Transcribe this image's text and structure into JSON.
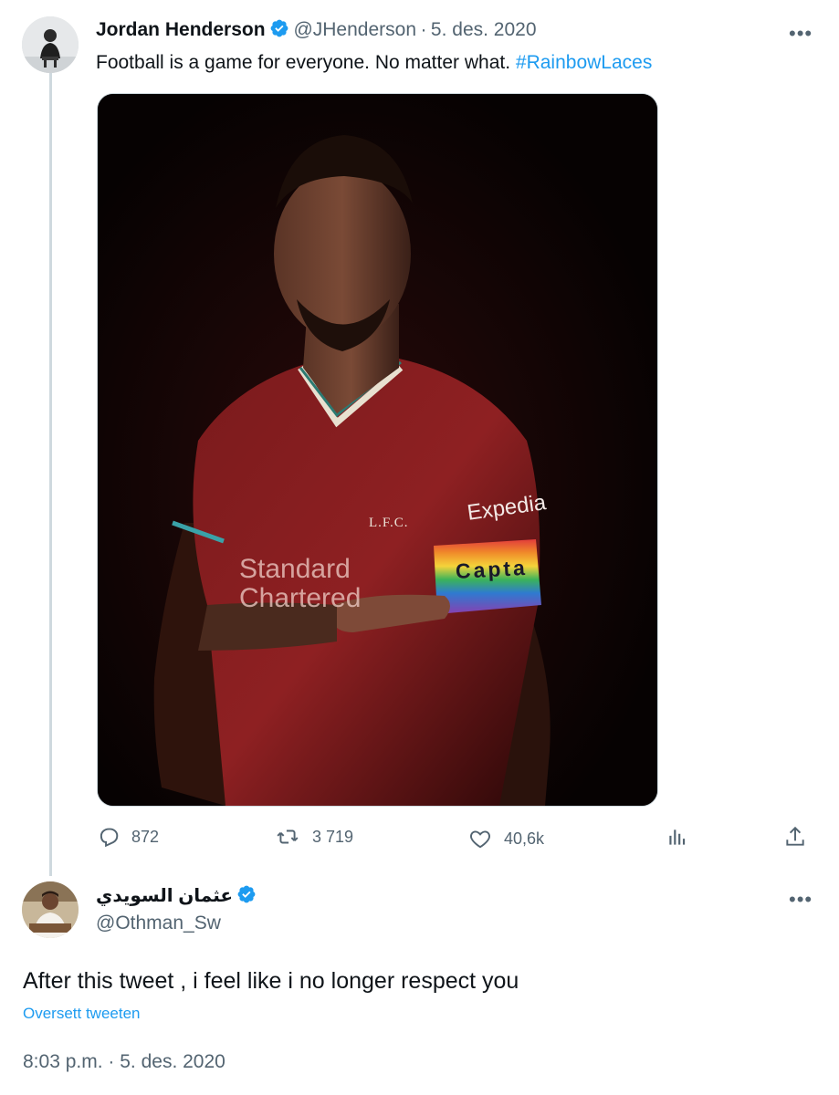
{
  "tweet": {
    "author_name": "Jordan Henderson",
    "handle": "@JHenderson",
    "separator": "·",
    "date": "5. des. 2020",
    "text": "Football is a game for everyone. No matter what.",
    "hashtag": "#RainbowLaces",
    "media": {
      "jersey_sponsor": "Standard\nChartered",
      "jersey_crest": "L.F.C.",
      "sleeve_sponsor": "Expedia",
      "armband_text": "Capta"
    },
    "actions": {
      "replies": "872",
      "retweets": "3 719",
      "likes": "40,6k"
    }
  },
  "reply": {
    "author_name": "عثمان السويدي",
    "handle": "@Othman_Sw",
    "text": "After this tweet , i feel like i no longer respect you",
    "translate_label": "Oversett tweeten",
    "time": "8:03 p.m.",
    "separator": "·",
    "date": "5. des. 2020"
  },
  "colors": {
    "accent": "#1d9bf0",
    "text": "#0f1419",
    "muted": "#536471",
    "verified": "#1d9bf0",
    "thread_line": "#cfd9de"
  },
  "icons": [
    "verified-badge-icon",
    "more-options-icon",
    "reply-icon",
    "retweet-icon",
    "like-icon",
    "analytics-icon",
    "share-icon"
  ]
}
